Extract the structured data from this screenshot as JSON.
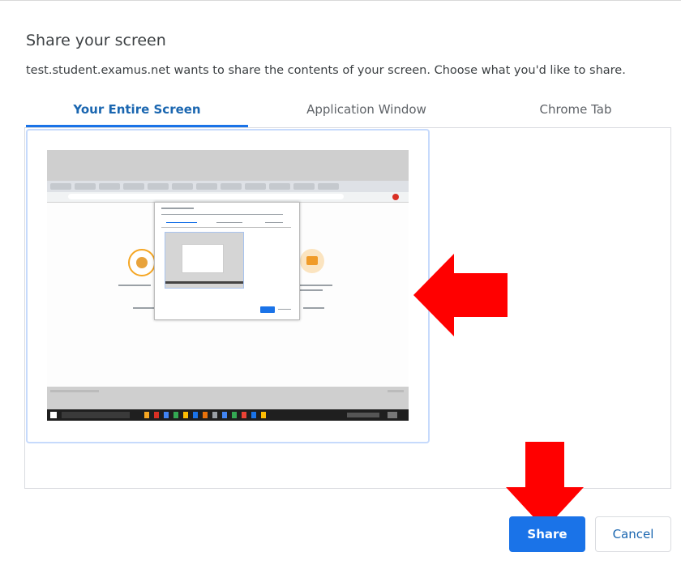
{
  "dialog": {
    "title": "Share your screen",
    "description": "test.student.examus.net wants to share the contents of your screen. Choose what you'd like to share."
  },
  "tabs": [
    {
      "label": "Your Entire Screen",
      "active": true
    },
    {
      "label": "Application Window",
      "active": false
    },
    {
      "label": "Chrome Tab",
      "active": false
    }
  ],
  "buttons": {
    "share_label": "Share",
    "cancel_label": "Cancel"
  },
  "colors": {
    "accent": "#1a73e8",
    "arrow": "#ff0000"
  },
  "annotations": [
    {
      "icon": "red-arrow-left-icon"
    },
    {
      "icon": "red-arrow-down-icon"
    }
  ]
}
